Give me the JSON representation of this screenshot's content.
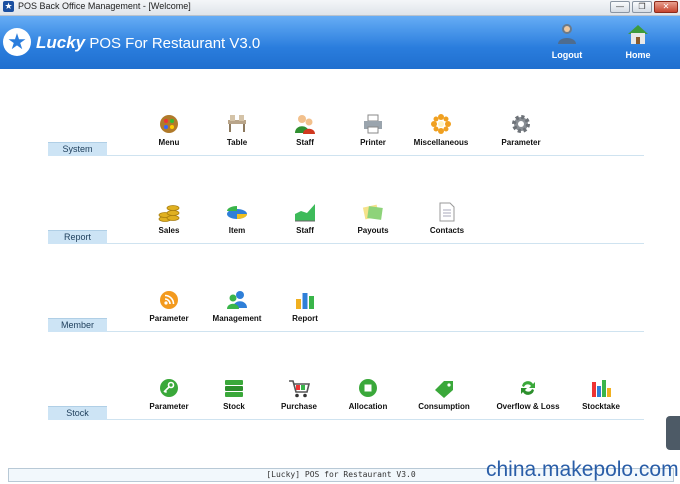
{
  "window": {
    "title": "POS Back Office Management - [Welcome]",
    "min_glyph": "—",
    "max_glyph": "❐",
    "close_glyph": "✕"
  },
  "header": {
    "brand": "Lucky",
    "product": "POS For Restaurant V3.0",
    "logout_label": "Logout",
    "home_label": "Home"
  },
  "sections": {
    "system": {
      "title": "System",
      "items": [
        {
          "label": "Menu",
          "icon": "menu-palette-icon"
        },
        {
          "label": "Table",
          "icon": "table-icon"
        },
        {
          "label": "Staff",
          "icon": "staff-icon"
        },
        {
          "label": "Printer",
          "icon": "printer-icon"
        },
        {
          "label": "Miscellaneous",
          "icon": "miscellaneous-icon"
        },
        {
          "label": "Parameter",
          "icon": "gear-icon"
        }
      ]
    },
    "report": {
      "title": "Report",
      "items": [
        {
          "label": "Sales",
          "icon": "coins-icon"
        },
        {
          "label": "Item",
          "icon": "pie-chart-icon"
        },
        {
          "label": "Staff",
          "icon": "area-chart-icon"
        },
        {
          "label": "Payouts",
          "icon": "payouts-icon"
        },
        {
          "label": "Contacts",
          "icon": "document-icon"
        }
      ]
    },
    "member": {
      "title": "Member",
      "items": [
        {
          "label": "Parameter",
          "icon": "rss-icon"
        },
        {
          "label": "Management",
          "icon": "users-icon"
        },
        {
          "label": "Report",
          "icon": "bar-chart-icon"
        }
      ]
    },
    "stock": {
      "title": "Stock",
      "items": [
        {
          "label": "Parameter",
          "icon": "key-icon"
        },
        {
          "label": "Stock",
          "icon": "stack-icon"
        },
        {
          "label": "Purchase",
          "icon": "cart-icon"
        },
        {
          "label": "Allocation",
          "icon": "stop-icon"
        },
        {
          "label": "Consumption",
          "icon": "tag-icon"
        },
        {
          "label": "Overflow & Loss",
          "icon": "recycle-icon"
        },
        {
          "label": "Stocktake",
          "icon": "stocktake-icon"
        }
      ]
    }
  },
  "footer": {
    "status": "[Lucky] POS for Restaurant V3.0"
  },
  "watermark": "china.makepolo.com",
  "colors": {
    "header_blue": "#2a7ddd",
    "section_label_bg": "#cde4f5"
  }
}
